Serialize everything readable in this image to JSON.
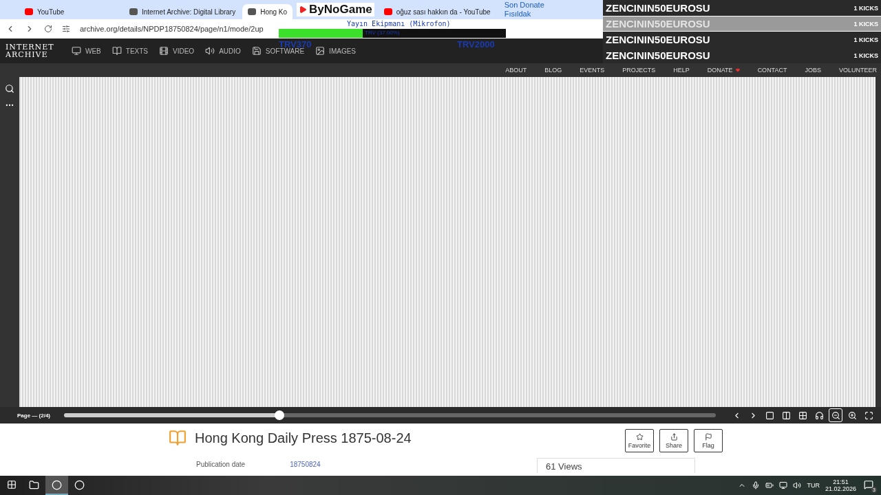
{
  "browser": {
    "tabs": [
      {
        "title": "YouTube",
        "kind": "youtube",
        "selected": false
      },
      {
        "title": "Internet Archive: Digital Library",
        "kind": "archive",
        "selected": false
      },
      {
        "title": "Hong Ko",
        "kind": "archive",
        "selected": true
      },
      {
        "title": "oğuz sası hakkın da - YouTube",
        "kind": "youtube",
        "selected": false
      }
    ],
    "url": "archive.org/details/NPDP18750824/page/n1/mode/2up"
  },
  "stream_overlay": {
    "logo": "ByNoGame",
    "goal": {
      "title": "Yayın Ekipmanı (Mikrofon)",
      "level": 0.37,
      "reading": "TRV (37.00%)",
      "current": "TRV370",
      "target": "TRV2000"
    },
    "donate_links": [
      "Son Donate",
      "Fısıldak"
    ],
    "donors": [
      {
        "name": "ZENCININ50EUROSU",
        "amount": "1 KICKS",
        "selected": false
      },
      {
        "name": "ZENCININ50EUROSU",
        "amount": "1 KICKS",
        "selected": true
      },
      {
        "name": "ZENCININ50EUROSU",
        "amount": "1 KICKS",
        "selected": false
      },
      {
        "name": "ZENCININ50EUROSU",
        "amount": "1 KICKS",
        "selected": false
      }
    ]
  },
  "site": {
    "logo": "INTERNET ARCHIVE",
    "media_nav": [
      {
        "label": "WEB",
        "kind": "web"
      },
      {
        "label": "TEXTS",
        "kind": "texts"
      },
      {
        "label": "VIDEO",
        "kind": "video"
      },
      {
        "label": "AUDIO",
        "kind": "audio"
      },
      {
        "label": "SOFTWARE",
        "kind": "software"
      },
      {
        "label": "IMAGES",
        "kind": "images"
      }
    ],
    "top_links": [
      {
        "label": "ABOUT",
        "heart": false
      },
      {
        "label": "BLOG",
        "heart": false
      },
      {
        "label": "EVENTS",
        "heart": false
      },
      {
        "label": "PROJECTS",
        "heart": false
      },
      {
        "label": "HELP",
        "heart": false
      },
      {
        "label": "DONATE",
        "heart": true
      },
      {
        "label": "CONTACT",
        "heart": false
      },
      {
        "label": "JOBS",
        "heart": false
      },
      {
        "label": "VOLUNTEER",
        "heart": false
      }
    ]
  },
  "viewer": {
    "page_label": "Page — (2/4)",
    "level": 0.33,
    "tools": [
      {
        "kind": "prev",
        "selected": false
      },
      {
        "kind": "next",
        "selected": false
      },
      {
        "kind": "one-page",
        "selected": false
      },
      {
        "kind": "two-page",
        "selected": false
      },
      {
        "kind": "thumbnails",
        "selected": false
      },
      {
        "kind": "read-aloud",
        "selected": false
      },
      {
        "kind": "zoom-out",
        "selected": true
      },
      {
        "kind": "zoom-in",
        "selected": false
      },
      {
        "kind": "fullscreen",
        "selected": false
      }
    ]
  },
  "item": {
    "title": "Hong Kong Daily Press 1875-08-24",
    "actions": [
      {
        "label": "Favorite",
        "kind": "star"
      },
      {
        "label": "Share",
        "kind": "share"
      },
      {
        "label": "Flag",
        "kind": "flag"
      }
    ],
    "metadata": [
      {
        "label": "Publication date",
        "value": "18750824"
      }
    ],
    "views": "61 Views"
  },
  "taskbar": {
    "apps": [
      {
        "kind": "explorer",
        "selected": false
      },
      {
        "kind": "chrome",
        "selected": true
      },
      {
        "kind": "obs",
        "selected": false
      }
    ],
    "language": "TUR",
    "time": "21:51",
    "date": "21.02.2026",
    "notifications": "3"
  }
}
